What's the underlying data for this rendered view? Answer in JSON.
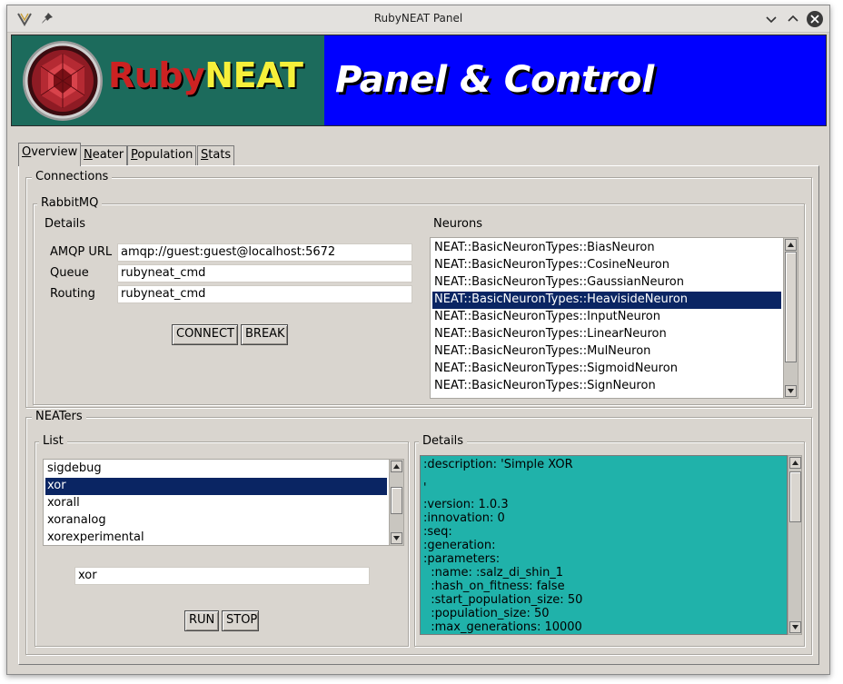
{
  "window": {
    "title": "RubyNEAT Panel"
  },
  "banner": {
    "logo_ruby": "Ruby",
    "logo_neat": "NEAT",
    "title": "Panel & Control"
  },
  "tabs": [
    {
      "label": "Overview",
      "ul": "O",
      "rest": "verview"
    },
    {
      "label": "Neater",
      "ul": "N",
      "rest": "eater"
    },
    {
      "label": "Population",
      "ul": "P",
      "rest": "opulation"
    },
    {
      "label": "Stats",
      "ul": "S",
      "rest": "tats"
    }
  ],
  "connections": {
    "label": "Connections",
    "rabbitmq": {
      "label": "RabbitMQ",
      "details_label": "Details",
      "amqp_url_label": "AMQP URL",
      "amqp_url_value": "amqp://guest:guest@localhost:5672",
      "queue_label": "Queue",
      "queue_value": "rubyneat_cmd",
      "routing_label": "Routing",
      "routing_value": "rubyneat_cmd",
      "connect_label": "CONNECT",
      "break_label": "BREAK",
      "neurons_label": "Neurons",
      "neurons": [
        "NEAT::BasicNeuronTypes::BiasNeuron",
        "NEAT::BasicNeuronTypes::CosineNeuron",
        "NEAT::BasicNeuronTypes::GaussianNeuron",
        "NEAT::BasicNeuronTypes::HeavisideNeuron",
        "NEAT::BasicNeuronTypes::InputNeuron",
        "NEAT::BasicNeuronTypes::LinearNeuron",
        "NEAT::BasicNeuronTypes::MulNeuron",
        "NEAT::BasicNeuronTypes::SigmoidNeuron",
        "NEAT::BasicNeuronTypes::SignNeuron"
      ],
      "neurons_selected": "NEAT::BasicNeuronTypes::HeavisideNeuron"
    }
  },
  "neaters": {
    "label": "NEATers",
    "list_label": "List",
    "items": [
      "sigdebug",
      "xor",
      "xorall",
      "xoranalog",
      "xorexperimental"
    ],
    "selected": "xor",
    "entry_value": "xor",
    "run_label": "RUN",
    "stop_label": "STOP",
    "details_label": "Details",
    "details_lines": [
      ":description: 'Simple XOR",
      "",
      "'",
      ":version: 1.0.3",
      ":innovation: 0",
      ":seq:",
      ":generation:",
      ":parameters:",
      "  :name: :salz_di_shin_1",
      "  :hash_on_fitness: false",
      "  :start_population_size: 50",
      "  :population_size: 50",
      "  :max_generations: 10000"
    ]
  },
  "colors": {
    "window_bg": "#d9d5cf",
    "selection": "#0a2563",
    "details_bg": "#20b2aa",
    "banner_blue": "#0000ff",
    "banner_green": "#1c6b5c"
  }
}
